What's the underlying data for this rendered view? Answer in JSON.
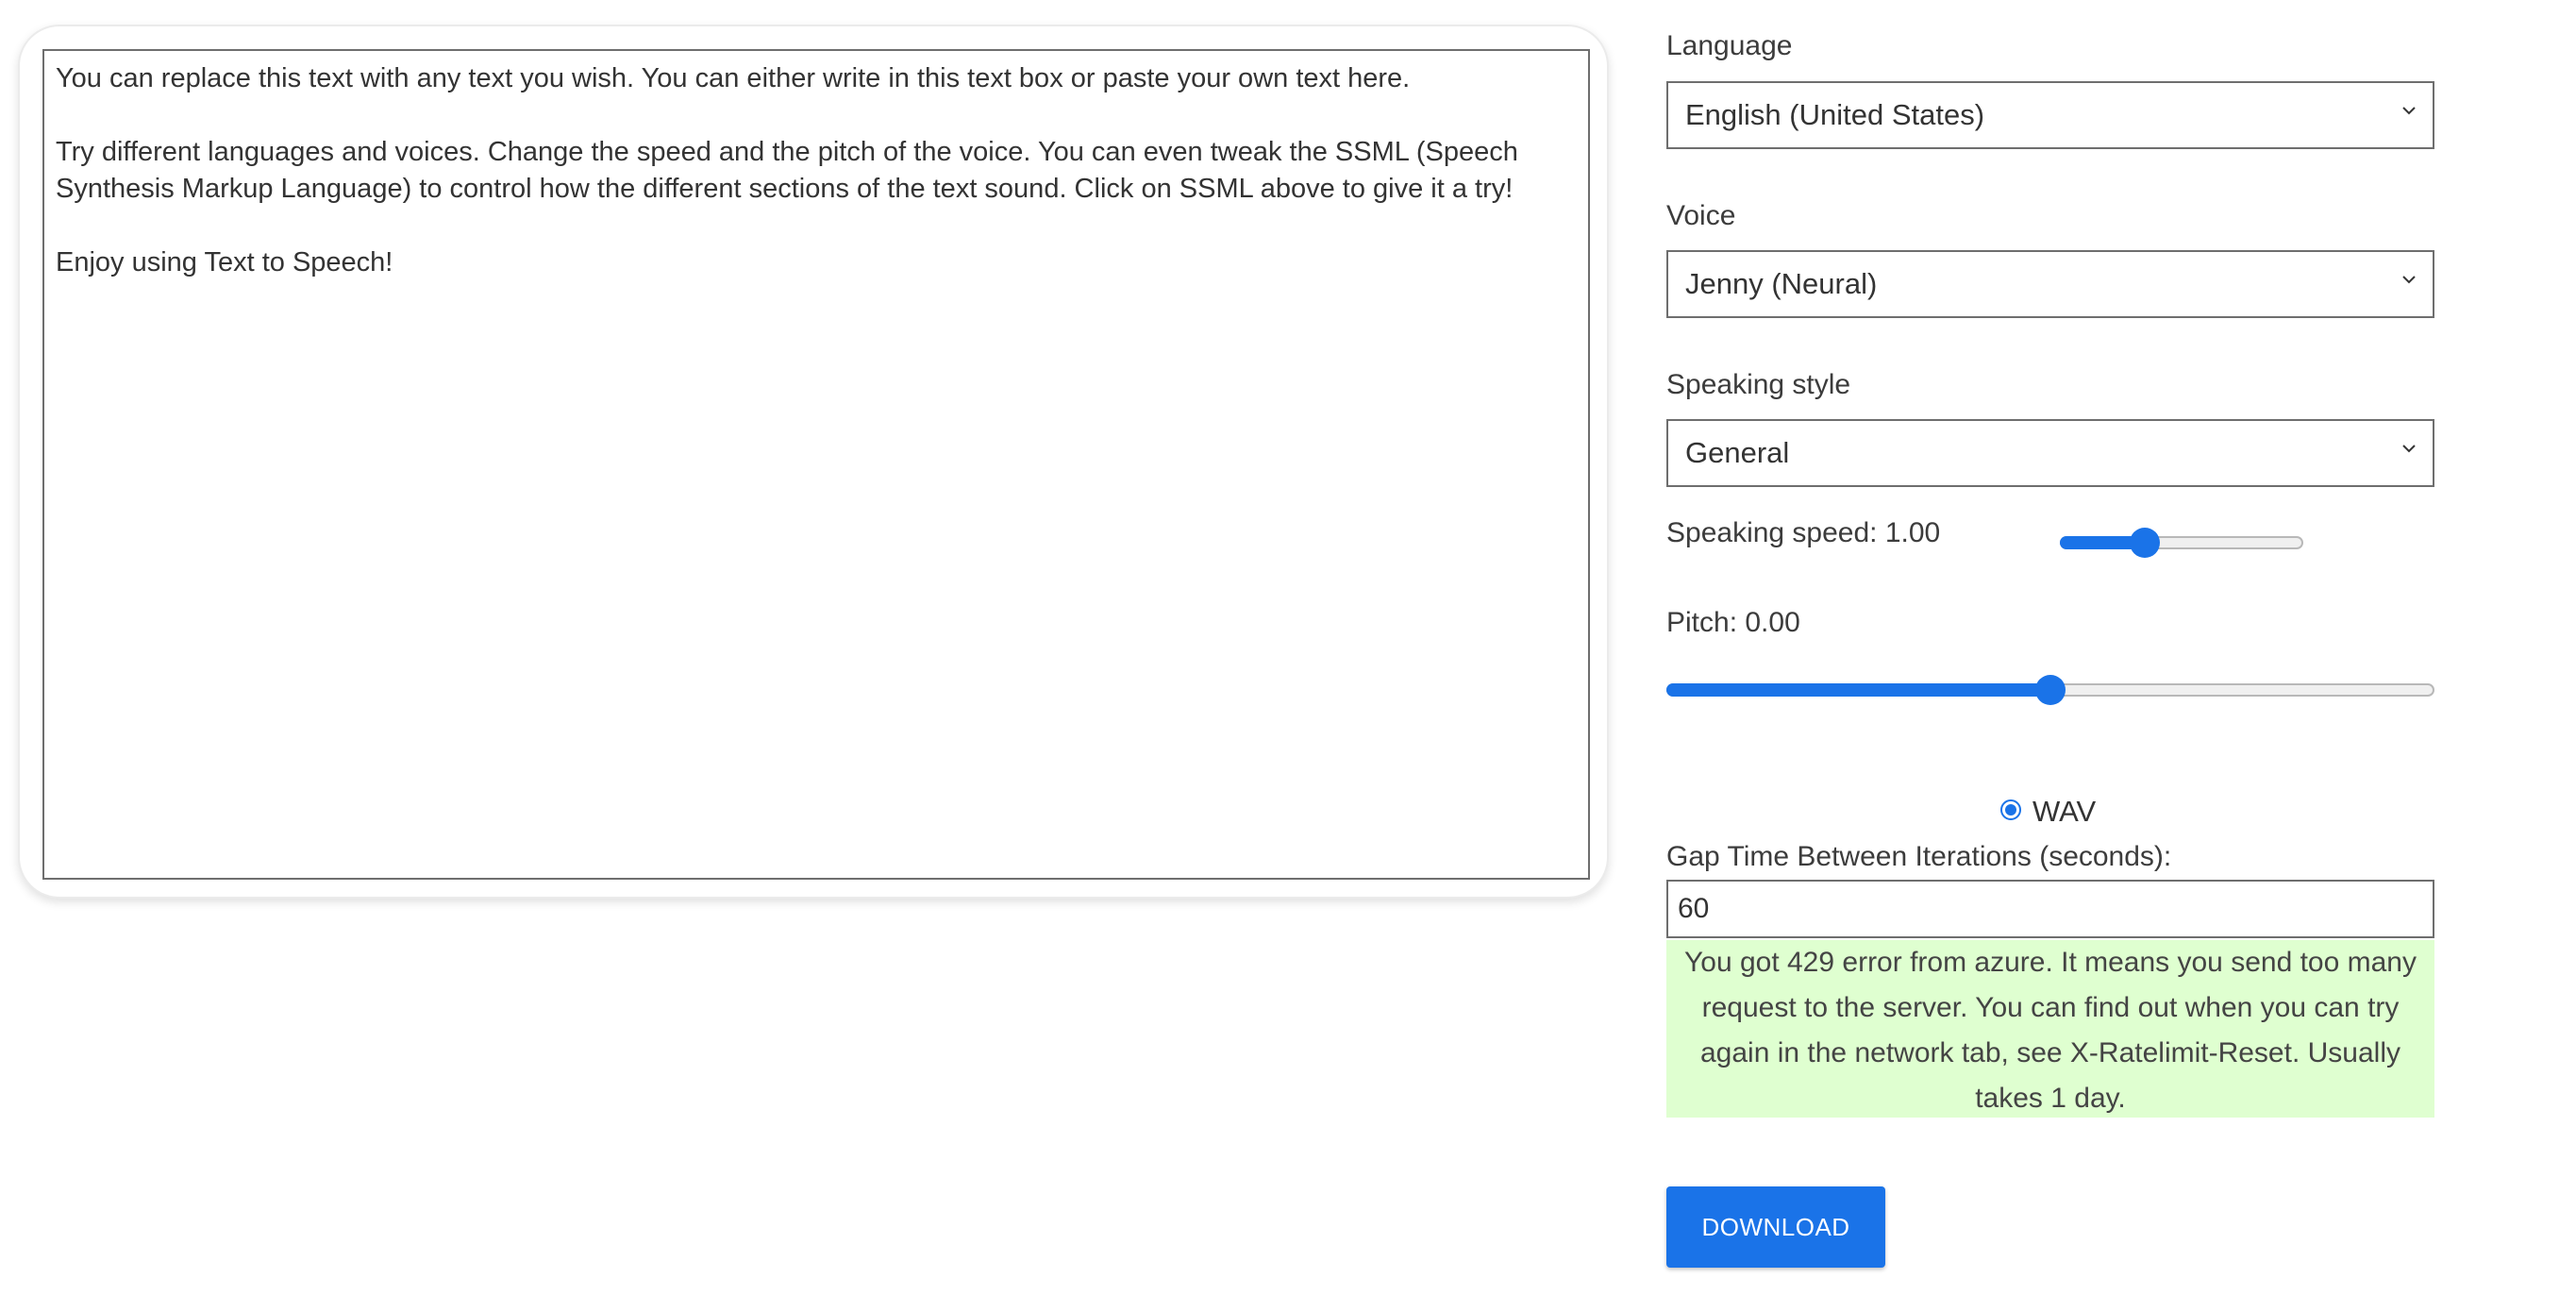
{
  "editor": {
    "text": "You can replace this text with any text you wish. You can either write in this text box or paste your own text here.\n\nTry different languages and voices. Change the speed and the pitch of the voice. You can even tweak the SSML (Speech Synthesis Markup Language) to control how the different sections of the text sound. Click on SSML above to give it a try!\n\nEnjoy using Text to Speech!"
  },
  "language": {
    "label": "Language",
    "value": "English (United States)"
  },
  "voice": {
    "label": "Voice",
    "value": "Jenny (Neural)"
  },
  "style": {
    "label": "Speaking style",
    "value": "General"
  },
  "speed": {
    "label": "Speaking speed: 1.00",
    "value": 1.0,
    "fill_fraction": 0.35
  },
  "pitch": {
    "label": "Pitch: 0.00",
    "value": 0.0,
    "fill_fraction": 0.5
  },
  "format": {
    "label": "WAV",
    "selected": true
  },
  "gap": {
    "label": "Gap Time Between Iterations (seconds):",
    "value": "60"
  },
  "alert": {
    "text": "You got 429 error from azure. It means you send too many request to the server. You can find out when you can try again in the network tab, see X-Ratelimit-Reset. Usually takes 1 day."
  },
  "download": {
    "label": "DOWNLOAD"
  },
  "colors": {
    "accent": "#1a73e8",
    "alert_background": "#dfffd0"
  },
  "icons": {
    "select": "chevron-down-icon",
    "radio": "radio-selected-icon"
  }
}
